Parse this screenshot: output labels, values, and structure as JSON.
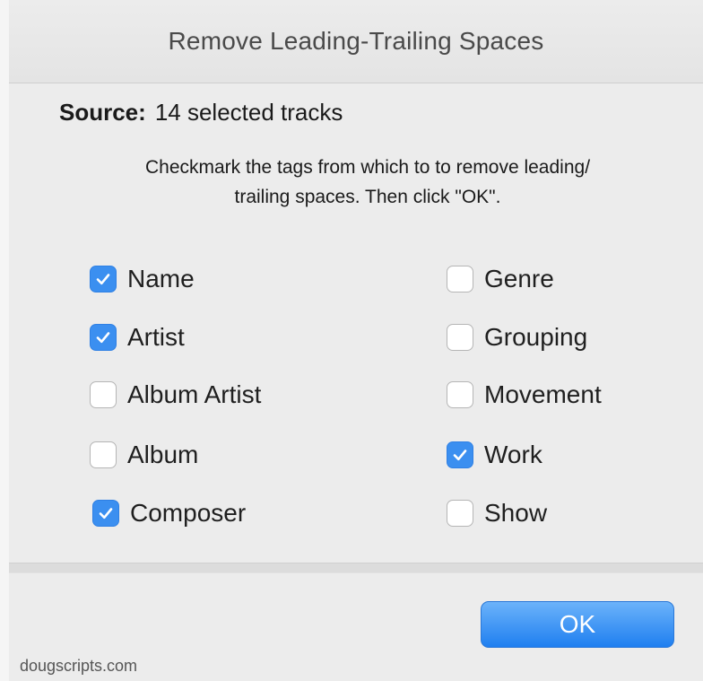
{
  "window": {
    "title": "Remove Leading-Trailing Spaces"
  },
  "source": {
    "label": "Source:",
    "value": "14 selected tracks"
  },
  "instructions": {
    "line1": "Checkmark the tags from which to to remove leading/",
    "line2": "trailing spaces. Then click \"OK\"."
  },
  "checkboxes": {
    "left": [
      {
        "label": "Name",
        "checked": true
      },
      {
        "label": "Artist",
        "checked": true
      },
      {
        "label": "Album Artist",
        "checked": false
      },
      {
        "label": "Album",
        "checked": false
      },
      {
        "label": "Composer",
        "checked": true
      }
    ],
    "right": [
      {
        "label": "Genre",
        "checked": false
      },
      {
        "label": "Grouping",
        "checked": false
      },
      {
        "label": "Movement",
        "checked": false
      },
      {
        "label": "Work",
        "checked": true
      },
      {
        "label": "Show",
        "checked": false
      }
    ]
  },
  "buttons": {
    "ok_label": "OK"
  },
  "footer": {
    "text": "dougscripts.com"
  },
  "colors": {
    "accent": "#3b8ff0",
    "button_top": "#6cb3fa",
    "button_bottom": "#1f7ff0"
  }
}
